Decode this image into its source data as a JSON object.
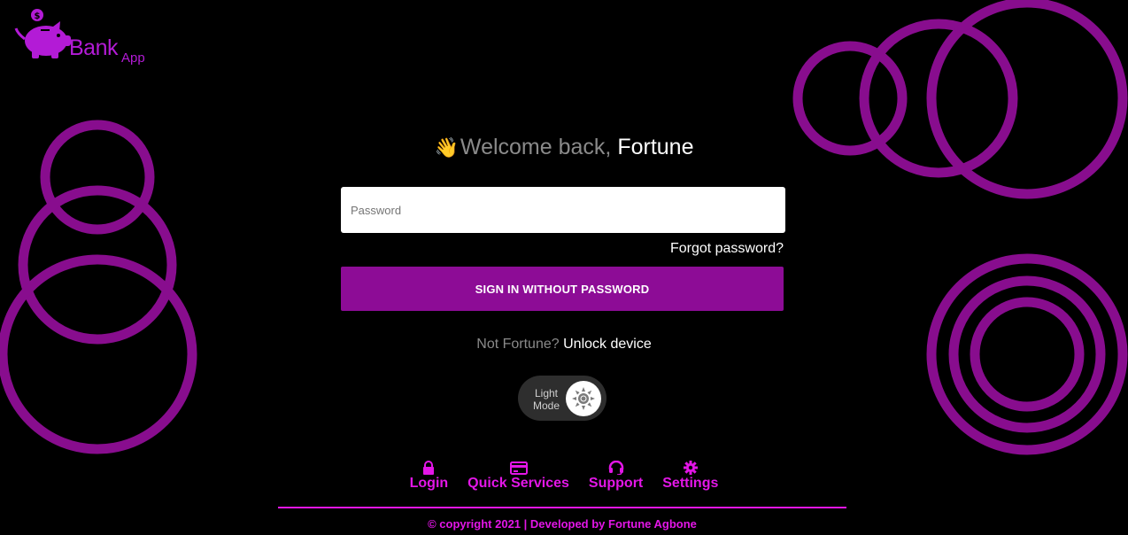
{
  "brand": {
    "name": "Bank",
    "suffix": "App",
    "logo_icon": "piggy-bank-icon",
    "color": "#b31bd6"
  },
  "welcome": {
    "icon": "waving-hand-icon",
    "icon_glyph": "👋",
    "greeting": "Welcome back,",
    "name": "Fortune"
  },
  "password_field": {
    "placeholder": "Password",
    "value": ""
  },
  "forgot_password": "Forgot password?",
  "signin_button": "SIGN IN WITHOUT PASSWORD",
  "not_user": {
    "question": "Not Fortune?",
    "action": "Unlock device"
  },
  "theme_toggle": {
    "label_line1": "Light",
    "label_line2": "Mode",
    "icon": "sun-icon"
  },
  "footer_nav": [
    {
      "label": "Login",
      "icon": "lock-icon"
    },
    {
      "label": "Quick Services",
      "icon": "credit-card-icon"
    },
    {
      "label": "Support",
      "icon": "headset-icon"
    },
    {
      "label": "Settings",
      "icon": "gear-icon"
    }
  ],
  "copyright": "© copyright 2021 | Developed by Fortune Agbone",
  "colors": {
    "background": "#000000",
    "accent": "#8d0c96",
    "ring": "#880d8e",
    "footer": "#e316e7"
  }
}
